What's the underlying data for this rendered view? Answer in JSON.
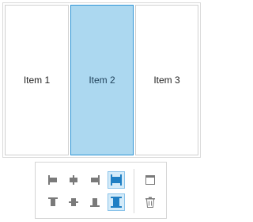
{
  "stack_panel": {
    "items": [
      {
        "label": "Item 1",
        "selected": false
      },
      {
        "label": "Item 2",
        "selected": true
      },
      {
        "label": "Item 3",
        "selected": false
      }
    ]
  },
  "toolbar": {
    "horizontal_alignment": {
      "buttons": [
        {
          "icon": "align-left-icon",
          "active": false
        },
        {
          "icon": "align-horizontal-center-icon",
          "active": false
        },
        {
          "icon": "align-right-icon",
          "active": false
        },
        {
          "icon": "stretch-horizontal-icon",
          "active": true
        }
      ]
    },
    "vertical_alignment": {
      "buttons": [
        {
          "icon": "align-top-icon",
          "active": false
        },
        {
          "icon": "align-vertical-center-icon",
          "active": false
        },
        {
          "icon": "align-bottom-icon",
          "active": false
        },
        {
          "icon": "stretch-vertical-icon",
          "active": true
        }
      ]
    },
    "actions": {
      "buttons": [
        {
          "icon": "window-icon"
        },
        {
          "icon": "trash-icon"
        }
      ]
    }
  },
  "colors": {
    "selected_fill": "#acd8f0",
    "selected_border": "#2f95d5",
    "icon_gray": "#7a7a7a",
    "active_icon": "#1f7fc4",
    "active_button_fill": "#d4ebf9"
  }
}
